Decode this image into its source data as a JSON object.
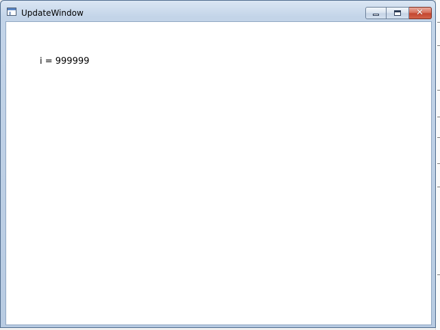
{
  "window": {
    "title": "UpdateWindow",
    "controls": {
      "minimize_icon": "minimize-icon",
      "maximize_icon": "restore-icon",
      "close_icon": "close-icon",
      "close_glyph": "✕"
    }
  },
  "client": {
    "text": "i = 999999"
  },
  "colors": {
    "frame": "#c3d4e8",
    "client_background": "#ffffff",
    "close_button": "#c4462f",
    "text": "#000000"
  }
}
